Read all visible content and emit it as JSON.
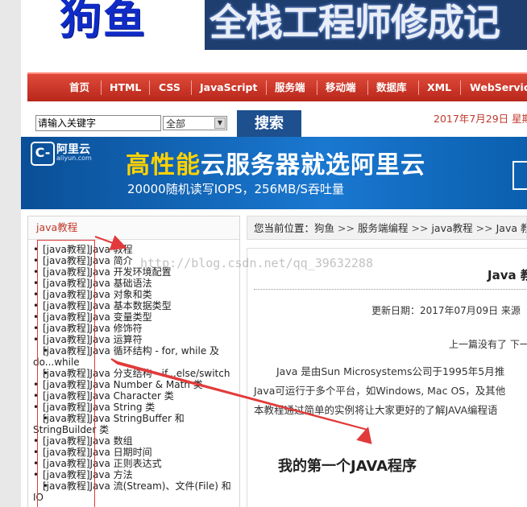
{
  "header": {
    "logo_text": "狗鱼",
    "banner_text": "全栈工程师修成记"
  },
  "nav": {
    "items": [
      "首页",
      "HTML",
      "CSS",
      "JavaScript",
      "服务端",
      "移动端",
      "数据库",
      "XML",
      "WebServic"
    ]
  },
  "search": {
    "input_value": "请输入关键字",
    "select_value": "全部",
    "button_label": "搜索",
    "date_text": "2017年7月29日 星期"
  },
  "ad": {
    "logo_glyph": "C-",
    "brand": "阿里云",
    "brand_sub": "aliyun.com",
    "headline_highlight": "高性能",
    "headline_rest": "云服务器就选阿里云",
    "tagline": "20000随机读写IOPS，256MB/S吞吐量"
  },
  "sidebar": {
    "title": "java教程",
    "items": [
      "[java教程]Java 教程",
      "[java教程]Java 简介",
      "[java教程]Java 开发环境配置",
      "[java教程]Java 基础语法",
      "[java教程]Java 对象和类",
      "[java教程]Java 基本数据类型",
      "[java教程]Java 变量类型",
      "[java教程]Java 修饰符",
      "[java教程]Java 运算符",
      "[java教程]Java 循环结构 - for, while 及 do...while",
      "[java教程]Java 分支结构 - if...else/switch",
      "[java教程]Java Number & Math 类",
      "[java教程]Java Character 类",
      "[java教程]Java String 类",
      "[java教程]Java StringBuffer 和 StringBuilder 类",
      "[java教程]Java 数组",
      "[java教程]Java 日期时间",
      "[java教程]Java 正则表达式",
      "[java教程]Java 方法",
      "[java教程]Java 流(Stream)、文件(File) 和IO"
    ]
  },
  "breadcrumb": {
    "label": "您当前位置：",
    "parts": [
      "狗鱼",
      "服务端编程",
      "java教程",
      "Java 教"
    ]
  },
  "article": {
    "title": "Java 教",
    "meta": "更新日期：2017年07月09日 来源",
    "prev_next": "上一篇没有了 下一",
    "paragraphs": [
      "Java 是由Sun Microsystems公司于1995年5月推",
      "Java可运行于多个平台，如Windows, Mac OS，及其他",
      "本教程通过简单的实例将让大家更好的了解JAVA编程语"
    ],
    "section_heading": "我的第一个JAVA程序"
  },
  "watermark": "http://blog.csdn.net/qq_39632288"
}
